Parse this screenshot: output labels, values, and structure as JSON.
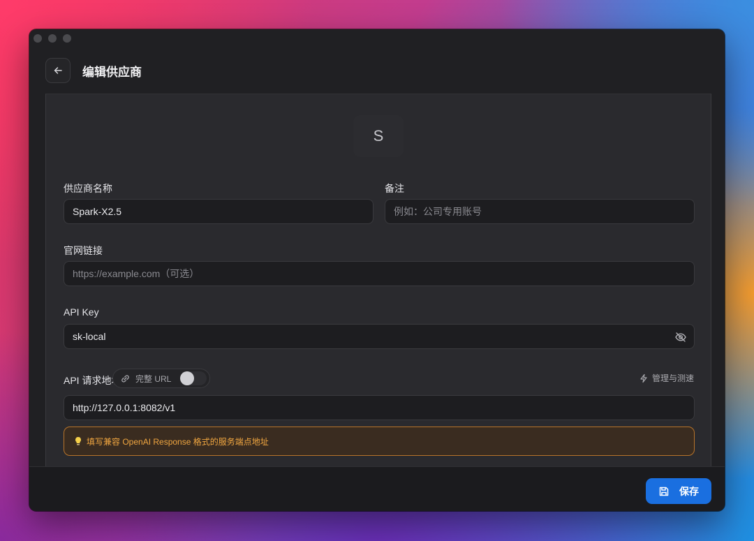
{
  "header": {
    "title": "编辑供应商"
  },
  "avatar": {
    "letter": "S"
  },
  "form": {
    "name_label": "供应商名称",
    "name_value": "Spark-X2.5",
    "note_label": "备注",
    "note_placeholder": "例如：公司专用账号",
    "website_label": "官网链接",
    "website_placeholder": "https://example.com（可选）",
    "apikey_label": "API Key",
    "apikey_value": "sk-local",
    "endpoint_label": "API 请求地址",
    "full_url_label": "完整 URL",
    "full_url_enabled": false,
    "manage_label": "管理与测速",
    "endpoint_value": "http://127.0.0.1:8082/v1",
    "hint_text": "填写兼容 OpenAI Response 格式的服务端点地址"
  },
  "footer": {
    "save_label": "保存"
  },
  "colors": {
    "accent": "#1a6fe0",
    "hint_border": "#b8742a",
    "hint_text": "#f0a640",
    "window_bg": "#202023"
  },
  "icons": {
    "back": "arrow-left-icon",
    "eye": "eye-off-icon",
    "link": "link-icon",
    "bolt": "lightning-icon",
    "bulb": "lightbulb-icon",
    "save": "save-icon"
  }
}
